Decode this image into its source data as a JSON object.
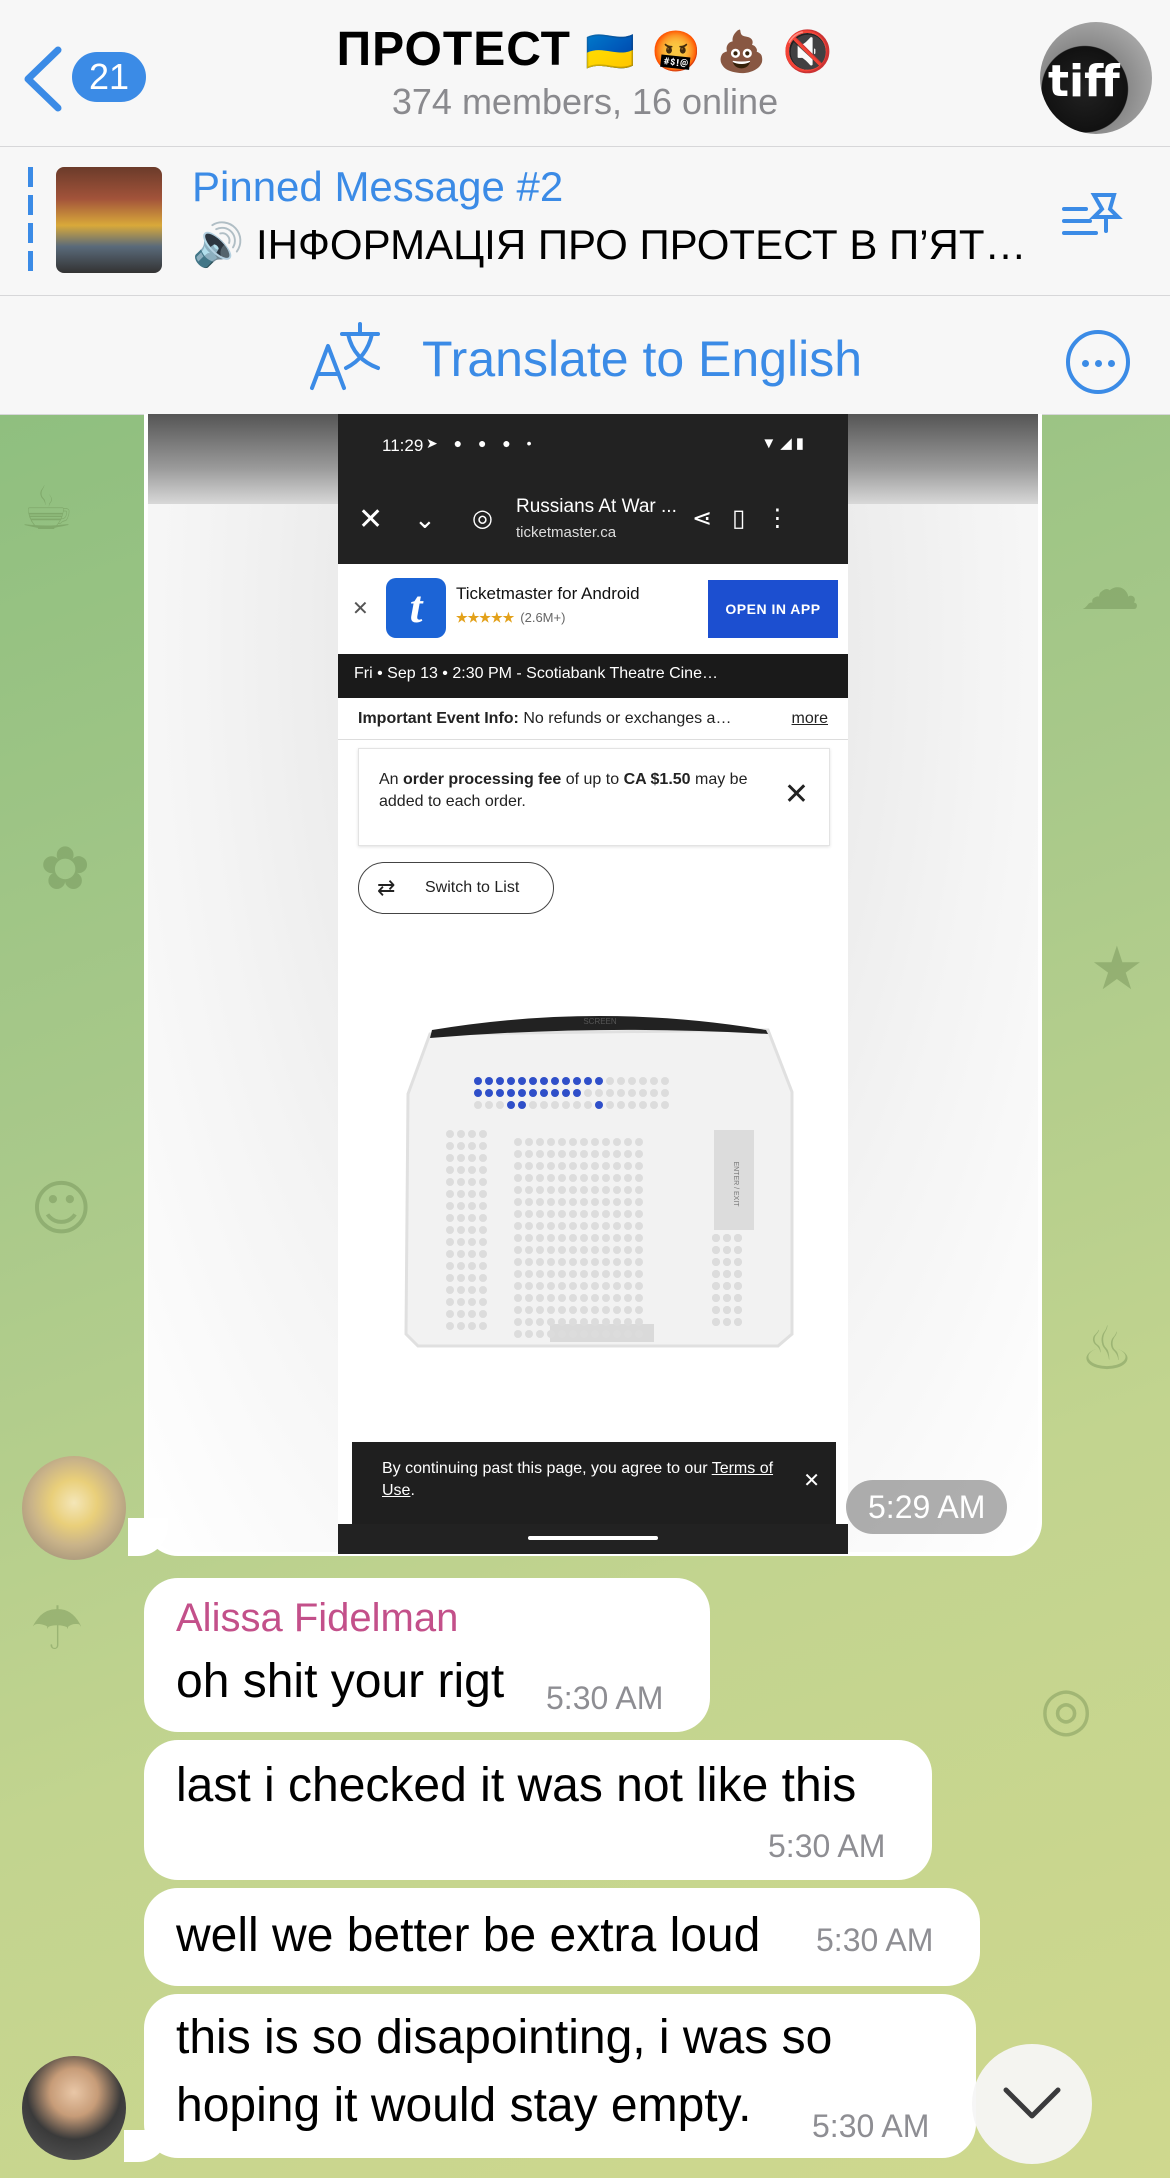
{
  "header": {
    "back_count": "21",
    "title": "ПРОТЕСТ",
    "title_emojis": "🇺🇦 🤬 💩 🔇",
    "subtitle": "374 members, 16 online",
    "avatar_text": "tiff"
  },
  "pinned": {
    "label": "Pinned Message #2",
    "text": "🔊 ІНФОРМАЦІЯ ПРО ПРОТЕСТ В П’ЯТ…"
  },
  "translate": {
    "label": "Translate to English"
  },
  "image_message": {
    "time": "5:29 AM",
    "screenshot": {
      "status_time": "11:29",
      "page_title": "Russians At War ...",
      "page_url": "ticketmaster.ca",
      "app_name": "Ticketmaster for Android",
      "app_rating": "★★★★★",
      "app_reviews": "(2.6M+)",
      "open_in_app": "OPEN IN APP",
      "event_line": "Fri • Sep 13 • 2:30 PM  - Scotiabank Theatre Cine…",
      "info_bold": "Important Event Info:",
      "info_text": " No refunds or exchanges a…",
      "info_more": "more",
      "fee_text_1": "An ",
      "fee_bold_1": "order processing fee",
      "fee_text_2": " of up to ",
      "fee_bold_2": "CA $1.50",
      "fee_text_3": " may be added to each order.",
      "switch_label": "Switch to List",
      "screen_label": "SCREEN",
      "exit_label": "ENTER / EXIT",
      "cookie_text": "By continuing past this page, you agree to our ",
      "cookie_link": "Terms of Use",
      "cookie_end": "."
    }
  },
  "messages": [
    {
      "sender": "Alissa Fidelman",
      "text": "oh shit your rigt",
      "time": "5:30 AM"
    },
    {
      "text": "last i checked it was not like this",
      "time": "5:30 AM"
    },
    {
      "text": "well we better be extra loud",
      "time": "5:30 AM"
    },
    {
      "text_line1": "this is so disapointing, i was so",
      "text_line2": "hoping it would stay empty.",
      "time": "5:30 AM"
    }
  ],
  "colors": {
    "accent": "#3b8be6",
    "sender_name": "#c3508a",
    "ticketmaster_blue": "#1c4fd0",
    "seat_taken": "#2f4fc9"
  }
}
